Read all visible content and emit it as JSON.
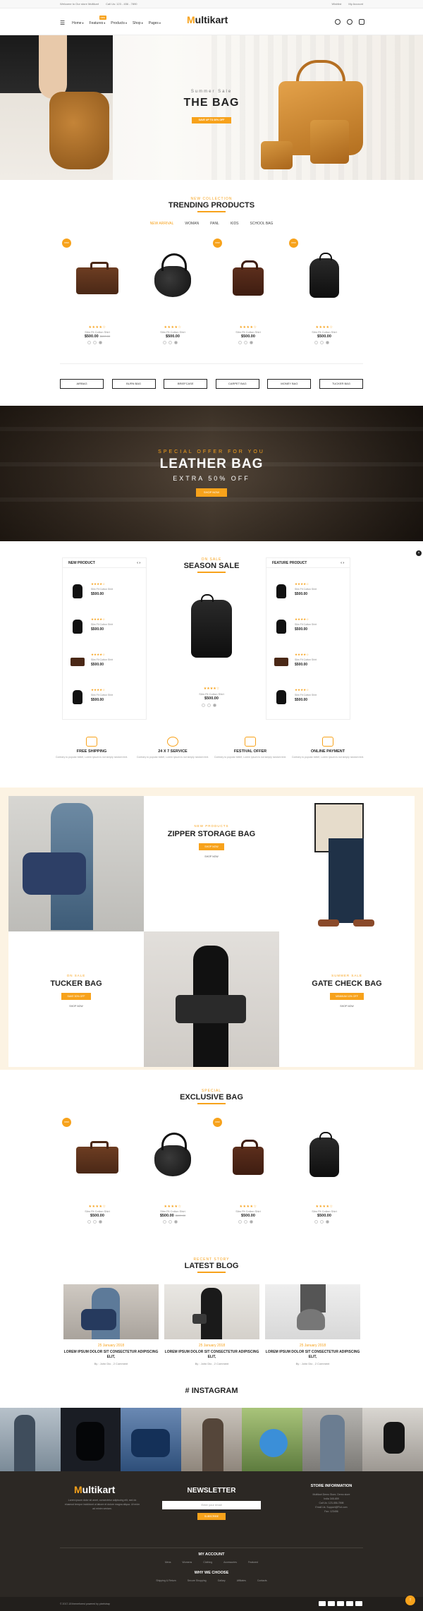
{
  "topbar": {
    "welcome": "Welcome to Our store Multikart",
    "phone": "Call Us: 123 - 456 - 7890",
    "wishlist": "Wishlist",
    "account": "My Account"
  },
  "logo": {
    "mark": "M",
    "rest": "ultikart"
  },
  "nav": {
    "items": [
      "Home",
      "Features",
      "Products",
      "Shop",
      "Pages"
    ],
    "new_badge": "new"
  },
  "hero": {
    "subtitle": "Summer Sale",
    "title": "THE BAG",
    "button": "SAVE UP TO 30% OFF"
  },
  "trending": {
    "subtitle": "NEW COLLECTION",
    "title": "TRENDING PRODUCTS",
    "tabs": [
      "NEW ARRIVAL",
      "WOMAN",
      "PANL",
      "KIDS",
      "SCHOOL BAG"
    ],
    "products": [
      {
        "badge": "new",
        "rating": "★★★★☆",
        "name": "Slim Fit Cotton Shirt",
        "price": "$500.00",
        "old": "$600.00"
      },
      {
        "badge": "",
        "rating": "★★★★☆",
        "name": "Slim Fit Cotton Shirt",
        "price": "$500.00",
        "old": ""
      },
      {
        "badge": "new",
        "rating": "★★★★☆",
        "name": "Slim Fit Cotton Shirt",
        "price": "$500.00",
        "old": ""
      },
      {
        "badge": "new",
        "rating": "★★★★☆",
        "name": "Slim Fit Cotton Shirt",
        "price": "$500.00",
        "old": ""
      }
    ]
  },
  "categories": [
    "AIRBAG",
    "BURN BAG",
    "BRIEFCASE",
    "CARPET BAG",
    "MONEY BAG",
    "TUCKER BAG"
  ],
  "leather": {
    "subtitle": "SPECIAL OFFER FOR YOU",
    "title": "LEATHER BAG",
    "offer": "EXTRA 50% OFF",
    "button": "SHOP NOW"
  },
  "season": {
    "subtitle": "ON SALE",
    "title": "SEASON SALE",
    "left_title": "NEW PRODUCT",
    "right_title": "FEATURE PRODUCT",
    "mini_rating": "★★★★☆",
    "mini_name": "Slim Fit Cotton Shirt",
    "mini_price": "$500.00",
    "center": {
      "rating": "★★★★☆",
      "name": "Slim Fit Cotton Shirt",
      "price": "$500.00"
    }
  },
  "features": [
    {
      "title": "FREE SHIPPING",
      "desc": "Contrary to popular belief, Lorem Ipsum is not simply random text."
    },
    {
      "title": "24 X 7 SERVICE",
      "desc": "Contrary to popular belief, Lorem Ipsum is not simply random text."
    },
    {
      "title": "FESTIVAL OFFER",
      "desc": "Contrary to popular belief, Lorem Ipsum is not simply random text."
    },
    {
      "title": "ONLINE PAYMENT",
      "desc": "Contrary to popular belief, Lorem Ipsum is not simply random text."
    }
  ],
  "collage": {
    "zipper": {
      "sub": "NEW PRODUCTS",
      "title": "ZIPPER STORAGE BAG",
      "btn": "SHOP NOW",
      "link": "SHOP NOW"
    },
    "tucker": {
      "sub": "ON SALE",
      "title": "TUCKER BAG",
      "btn": "SAVE 30% OFF",
      "link": "SHOP NOW"
    },
    "gate": {
      "sub": "SUMMER SALE",
      "title": "GATE CHECK BAG",
      "btn": "MINIMUM 10% OFF",
      "link": "SHOP NOW"
    }
  },
  "exclusive": {
    "subtitle": "SPECIAL",
    "title": "EXCLUSIVE BAG",
    "products": [
      {
        "badge": "new",
        "rating": "★★★★☆",
        "name": "Slim Fit Cotton Shirt",
        "price": "$500.00",
        "old": ""
      },
      {
        "badge": "",
        "rating": "★★★★☆",
        "name": "Slim Fit Cotton Shirt",
        "price": "$500.00",
        "old": "$600.00"
      },
      {
        "badge": "new",
        "rating": "★★★★☆",
        "name": "Slim Fit Cotton Shirt",
        "price": "$500.00",
        "old": ""
      },
      {
        "badge": "",
        "rating": "★★★★☆",
        "name": "Slim Fit Cotton Shirt",
        "price": "$500.00",
        "old": ""
      }
    ]
  },
  "blog": {
    "subtitle": "RECENT STORY",
    "title": "LATEST BLOG",
    "posts": [
      {
        "date": "25 January 2018",
        "title": "LOREM IPSUM DOLOR SIT CONSECTETUR ADIPISCING ELIT,",
        "meta": "By : John Dio , 2 Comment"
      },
      {
        "date": "25 January 2018",
        "title": "LOREM IPSUM DOLOR SIT CONSECTETUR ADIPISCING ELIT,",
        "meta": "By : John Dio , 2 Comment"
      },
      {
        "date": "25 January 2018",
        "title": "LOREM IPSUM DOLOR SIT CONSECTETUR ADIPISCING ELIT,",
        "meta": "By : John Dio , 2 Comment"
      }
    ]
  },
  "instagram": {
    "title": "# INSTAGRAM"
  },
  "footer": {
    "about": "Lorem ipsum dolor sit amet, consectetur adipiscing elit, sed do eiusmod tempor incididunt ut labore et dolore magna aliqua. Ut enim ad minim veniam.",
    "newsletter_title": "NEWSLETTER",
    "email_placeholder": "Enter your email",
    "subscribe": "SUBSCRIBE",
    "store_title": "STORE INFORMATION",
    "store_lines": [
      "Multikart Demo Store, Demo store",
      "India 345-659",
      "Call Us: 123-456-7898",
      "Email Us: Support@Fiot.com",
      "Fax: 123456"
    ],
    "account_title": "MY ACCOUNT",
    "account_links": [
      "Mens",
      "Womens",
      "Clothing",
      "Accessories",
      "Featured"
    ],
    "why_title": "WHY WE CHOOSE",
    "why_links": [
      "Shipping & Return",
      "Secure Shopping",
      "Gallary",
      "Affiliates",
      "Contacts"
    ],
    "copyright": "© 2017-18 themeforest powered by pixelstrap"
  },
  "colors": {
    "accent": "#f7a21b",
    "dark": "#2c2824"
  }
}
